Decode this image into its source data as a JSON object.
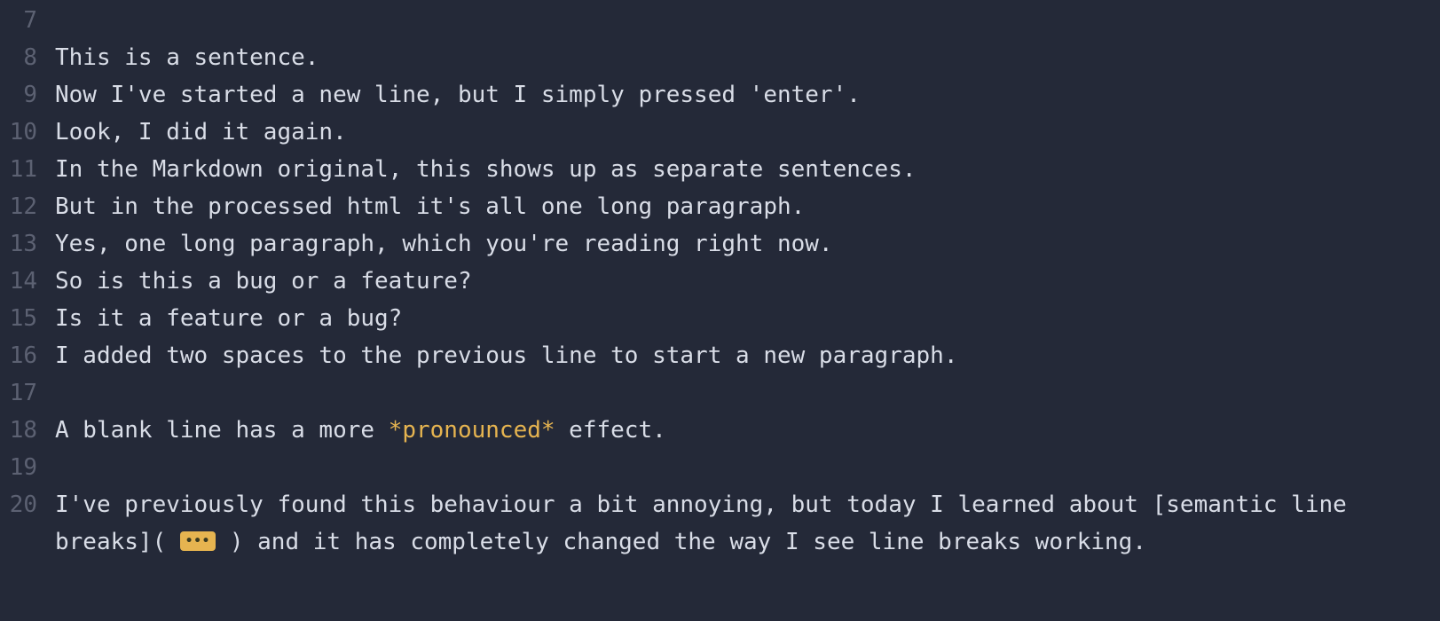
{
  "editor": {
    "lines": [
      {
        "number": 7,
        "segments": []
      },
      {
        "number": 8,
        "segments": [
          {
            "kind": "text",
            "text": "This is a sentence."
          }
        ]
      },
      {
        "number": 9,
        "segments": [
          {
            "kind": "text",
            "text": "Now I've started a new line, but I simply pressed 'enter'."
          }
        ]
      },
      {
        "number": 10,
        "segments": [
          {
            "kind": "text",
            "text": "Look, I did it again."
          }
        ]
      },
      {
        "number": 11,
        "segments": [
          {
            "kind": "text",
            "text": "In the Markdown original, this shows up as separate sentences."
          }
        ]
      },
      {
        "number": 12,
        "segments": [
          {
            "kind": "text",
            "text": "But in the processed html it's all one long paragraph."
          }
        ]
      },
      {
        "number": 13,
        "segments": [
          {
            "kind": "text",
            "text": "Yes, one long paragraph, which you're reading right now."
          }
        ]
      },
      {
        "number": 14,
        "segments": [
          {
            "kind": "text",
            "text": "So is this a bug or a feature?"
          }
        ]
      },
      {
        "number": 15,
        "segments": [
          {
            "kind": "text",
            "text": "Is it a feature or a bug?"
          }
        ]
      },
      {
        "number": 16,
        "segments": [
          {
            "kind": "text",
            "text": "I added two spaces to the previous line to start a new paragraph."
          }
        ]
      },
      {
        "number": 17,
        "segments": []
      },
      {
        "number": 18,
        "segments": [
          {
            "kind": "text",
            "text": "A blank line has a more "
          },
          {
            "kind": "em",
            "text": "*pronounced*"
          },
          {
            "kind": "text",
            "text": " effect."
          }
        ]
      },
      {
        "number": 19,
        "segments": []
      },
      {
        "number": 20,
        "segments": [
          {
            "kind": "text",
            "text": "I've previously found this behaviour a bit annoying, but today I learned about "
          },
          {
            "kind": "link-open",
            "text": "["
          },
          {
            "kind": "link-text",
            "text": "semantic line breaks"
          },
          {
            "kind": "link-close",
            "text": "]"
          },
          {
            "kind": "paren",
            "text": "("
          },
          {
            "kind": "collapsed-url",
            "glyph": "•••"
          },
          {
            "kind": "paren",
            "text": ")"
          },
          {
            "kind": "text",
            "text": " and it has completely changed the way I see line breaks working."
          }
        ]
      }
    ]
  }
}
